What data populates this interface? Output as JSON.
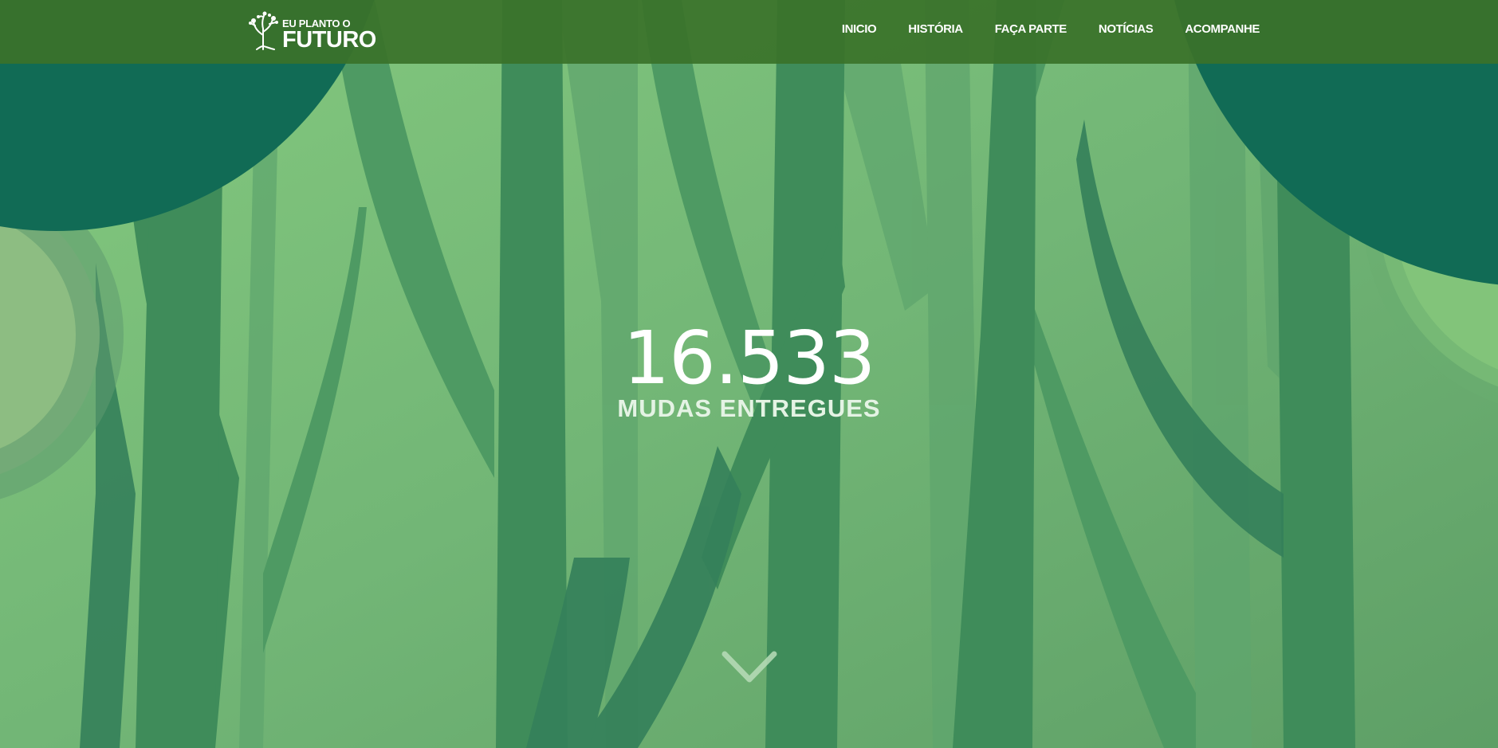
{
  "brand": {
    "logo_line1": "EU PLANTO O",
    "logo_line2": "FUTURO"
  },
  "nav": {
    "items": [
      {
        "label": "INICIO"
      },
      {
        "label": "HISTÓRIA"
      },
      {
        "label": "FAÇA PARTE"
      },
      {
        "label": "NOTÍCIAS"
      },
      {
        "label": "ACOMPANHE"
      }
    ]
  },
  "hero": {
    "counter_value": "16.533",
    "counter_caption": "MUDAS ENTREGUES"
  },
  "icons": {
    "logo": "tree-icon",
    "scroll": "chevron-down-icon"
  },
  "colors": {
    "navbar": "#3a722a",
    "background": "#74b777",
    "trunk_dark": "#2f7a50",
    "canopy": "#116b55",
    "text": "#ffffff"
  }
}
